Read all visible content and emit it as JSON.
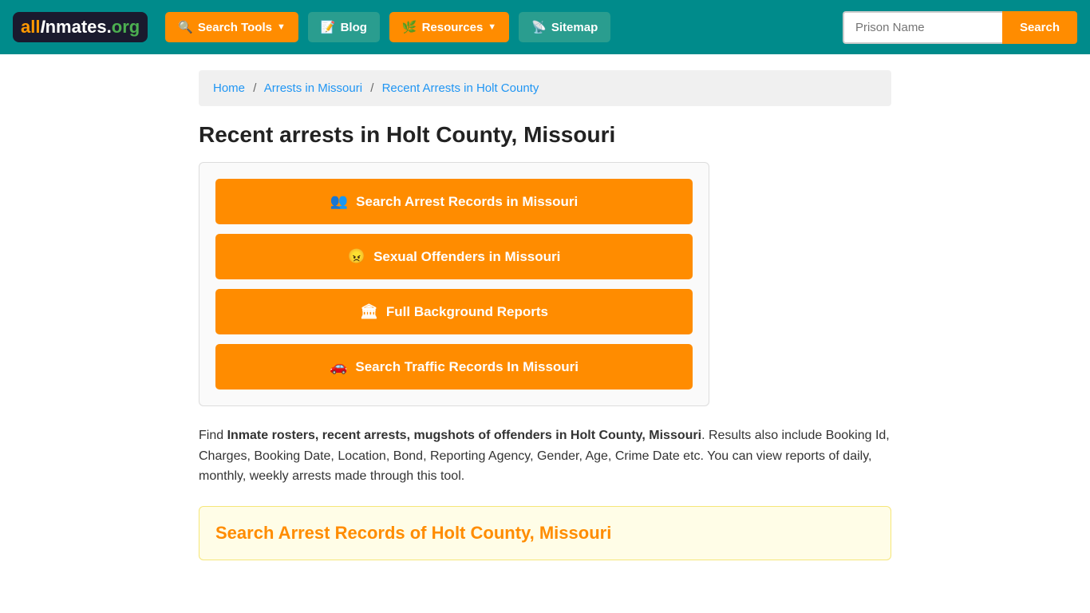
{
  "header": {
    "logo_text": "allInmates.org",
    "nav_items": [
      {
        "label": "Search Tools",
        "id": "search-tools",
        "icon": "🔍",
        "has_dropdown": true
      },
      {
        "label": "Blog",
        "id": "blog",
        "icon": "📝",
        "has_dropdown": false
      },
      {
        "label": "Resources",
        "id": "resources",
        "icon": "🌿",
        "has_dropdown": true
      },
      {
        "label": "Sitemap",
        "id": "sitemap",
        "icon": "📡",
        "has_dropdown": false
      }
    ],
    "search_placeholder": "Prison Name",
    "search_button_label": "Search"
  },
  "breadcrumb": {
    "home_label": "Home",
    "home_href": "#",
    "separator1": "/",
    "arrests_label": "Arrests in Missouri",
    "arrests_href": "#",
    "separator2": "/",
    "current_label": "Recent Arrests in Holt County"
  },
  "page": {
    "title": "Recent arrests in Holt County, Missouri",
    "action_buttons": [
      {
        "id": "search-arrest",
        "icon": "👥",
        "label": "Search Arrest Records in Missouri"
      },
      {
        "id": "sexual-offenders",
        "icon": "😠",
        "label": "Sexual Offenders in Missouri"
      },
      {
        "id": "background-reports",
        "icon": "🏛",
        "label": "Full Background Reports"
      },
      {
        "id": "traffic-records",
        "icon": "🚗",
        "label": "Search Traffic Records In Missouri"
      }
    ],
    "description_part1": "Find ",
    "description_bold": "Inmate rosters, recent arrests, mugshots of offenders in Holt County, Missouri",
    "description_part2": ". Results also include Booking Id, Charges, Booking Date, Location, Bond, Reporting Agency, Gender, Age, Crime Date etc. You can view reports of daily, monthly, weekly arrests made through this tool.",
    "section_title": "Search Arrest Records of Holt County, Missouri"
  }
}
